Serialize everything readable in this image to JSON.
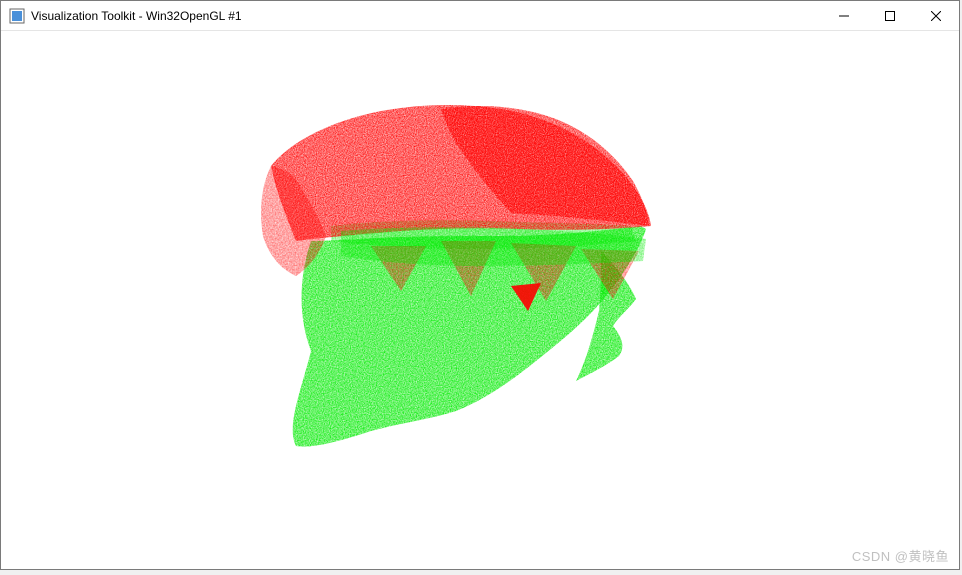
{
  "window": {
    "title": "Visualization Toolkit - Win32OpenGL #1",
    "app_icon_name": "vtk-app-icon"
  },
  "controls": {
    "minimize_label": "—",
    "maximize_label": "☐",
    "close_label": "✕"
  },
  "viewport": {
    "background": "#ffffff",
    "render": {
      "type": "pointcloud",
      "description": "Two overlapping 3D point-cloud surfaces (human head profile), red cloud on upper portion, green cloud on lower portion, partially interleaved",
      "clouds": [
        {
          "name": "cloud-red",
          "color": "#ff0000",
          "region": "upper"
        },
        {
          "name": "cloud-green",
          "color": "#00d400",
          "region": "lower"
        }
      ]
    }
  },
  "watermark": {
    "prefix": "CSDN",
    "author": "@黄晓鱼"
  }
}
